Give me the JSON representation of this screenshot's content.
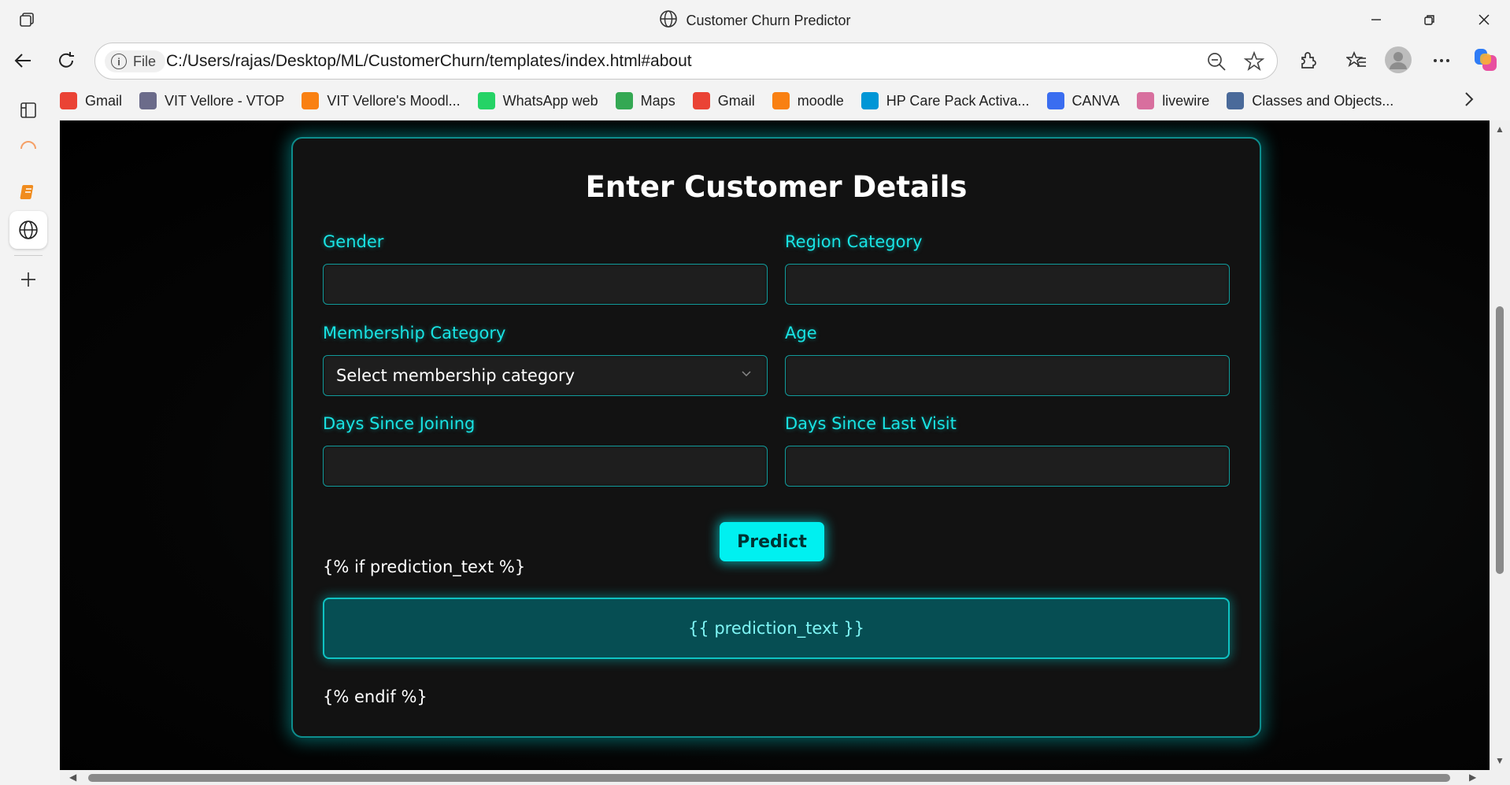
{
  "window": {
    "title": "Customer Churn Predictor",
    "minimize_icon": "minimize-icon",
    "restore_icon": "restore-icon",
    "close_icon": "close-icon"
  },
  "address_bar": {
    "info_label": "File",
    "url": "C:/Users/rajas/Desktop/ML/CustomerChurn/templates/index.html#about"
  },
  "bookmarks": [
    {
      "label": "Gmail",
      "icon": "gmail-icon",
      "color": "#ea4335"
    },
    {
      "label": "VIT Vellore - VTOP",
      "icon": "vtop-icon",
      "color": "#6b6b8a"
    },
    {
      "label": "VIT Vellore's Moodl...",
      "icon": "moodle-icon",
      "color": "#f98012"
    },
    {
      "label": "WhatsApp web",
      "icon": "whatsapp-icon",
      "color": "#25d366"
    },
    {
      "label": "Maps",
      "icon": "maps-icon",
      "color": "#34a853"
    },
    {
      "label": "Gmail",
      "icon": "gmail-icon",
      "color": "#ea4335"
    },
    {
      "label": "moodle",
      "icon": "moodle-icon",
      "color": "#f98012"
    },
    {
      "label": "HP Care Pack Activa...",
      "icon": "hp-icon",
      "color": "#0096d6"
    },
    {
      "label": "CANVA",
      "icon": "canva-icon",
      "color": "#3a6df0"
    },
    {
      "label": "livewire",
      "icon": "livewire-icon",
      "color": "#d86f9e"
    },
    {
      "label": "Classes and Objects...",
      "icon": "brain-icon",
      "color": "#4a6a9a"
    }
  ],
  "form": {
    "heading": "Enter Customer Details",
    "fields": {
      "gender": {
        "label": "Gender",
        "value": ""
      },
      "region": {
        "label": "Region Category",
        "value": ""
      },
      "membership": {
        "label": "Membership Category",
        "value": "Select membership category"
      },
      "age": {
        "label": "Age",
        "value": ""
      },
      "days_joining": {
        "label": "Days Since Joining",
        "value": ""
      },
      "days_last_visit": {
        "label": "Days Since Last Visit",
        "value": ""
      }
    },
    "predict_label": "Predict",
    "template_if": "{% if prediction_text %}",
    "result_text": "{{ prediction_text }}",
    "template_endif": "{% endif %}"
  },
  "colors": {
    "accent": "#00f0f0",
    "label": "#19e3e3",
    "card_bg": "#121212",
    "result_bg": "#064e53"
  }
}
